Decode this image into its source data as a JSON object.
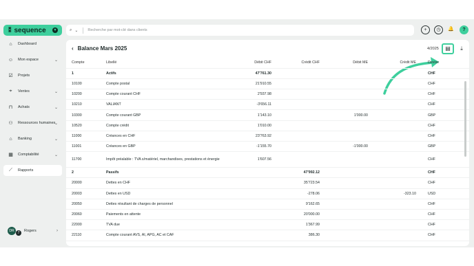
{
  "app": {
    "logo_text": "sequence",
    "logo_mark": "⁑"
  },
  "search": {
    "placeholder": "Recherche par mot-clé dans clients"
  },
  "sidebar": {
    "items": [
      {
        "label": "Dashboard"
      },
      {
        "label": "Mon espace"
      },
      {
        "label": "Projets"
      },
      {
        "label": "Ventes"
      },
      {
        "label": "Achats"
      },
      {
        "label": "Ressources humaines"
      },
      {
        "label": "Banking"
      },
      {
        "label": "Comptabilité"
      },
      {
        "label": "Rapports"
      }
    ],
    "user": {
      "name": "Rogers",
      "initials": "DR",
      "badge": "7"
    }
  },
  "report": {
    "title": "Balance Mars 2025",
    "date_fragment": "4/2025",
    "columns": [
      "Compte",
      "Libellé",
      "Débit CHF",
      "Crédit CHF",
      "Débit ME",
      "Crédit ME",
      "Devise"
    ],
    "rows": [
      {
        "compte": "1",
        "libelle": "Actifs",
        "debit": "47'761.30",
        "credit": "",
        "dme": "",
        "cme": "",
        "devise": "CHF",
        "bold": true
      },
      {
        "compte": "10100",
        "libelle": "Compte postal",
        "debit": "21'910.55",
        "credit": "",
        "dme": "",
        "cme": "",
        "devise": "CHF"
      },
      {
        "compte": "10200",
        "libelle": "Compte courant CHF",
        "debit": "2'937.98",
        "credit": "",
        "dme": "",
        "cme": "",
        "devise": "CHF"
      },
      {
        "compte": "10210",
        "libelle": "VALIANT",
        "debit": "-3'656.11",
        "credit": "",
        "dme": "",
        "cme": "",
        "devise": "CHF"
      },
      {
        "compte": "10300",
        "libelle": "Compte courant GBP",
        "debit": "1'143.10",
        "credit": "",
        "dme": "1'000.00",
        "cme": "",
        "devise": "GBP"
      },
      {
        "compte": "10520",
        "libelle": "Compte crédit",
        "debit": "1'010.00",
        "credit": "",
        "dme": "",
        "cme": "",
        "devise": "CHF"
      },
      {
        "compte": "11000",
        "libelle": "Créances en CHF",
        "debit": "23'763.92",
        "credit": "",
        "dme": "",
        "cme": "",
        "devise": "CHF"
      },
      {
        "compte": "11001",
        "libelle": "Créances en GBP",
        "debit": "-1'155.70",
        "credit": "",
        "dme": "-1'000.00",
        "cme": "",
        "devise": "GBP"
      },
      {
        "compte": "11700",
        "libelle": "Impôt préalable : TVA s/matériel, marchandises, prestations et énergie",
        "debit": "1'607.56",
        "credit": "",
        "dme": "",
        "cme": "",
        "devise": "CHF",
        "tall": true
      },
      {
        "compte": "2",
        "libelle": "Passifs",
        "debit": "",
        "credit": "47'992.12",
        "dme": "",
        "cme": "",
        "devise": "CHF",
        "bold": true
      },
      {
        "compte": "20000",
        "libelle": "Dettes en CHF",
        "debit": "",
        "credit": "35'723.54",
        "dme": "",
        "cme": "",
        "devise": "CHF"
      },
      {
        "compte": "20003",
        "libelle": "Dettes en USD",
        "debit": "",
        "credit": "-278.06",
        "dme": "",
        "cme": "-323.10",
        "devise": "USD"
      },
      {
        "compte": "20050",
        "libelle": "Dettes résultant de charges de personnel",
        "debit": "",
        "credit": "9'162.65",
        "dme": "",
        "cme": "",
        "devise": "CHF"
      },
      {
        "compte": "20060",
        "libelle": "Paiements en attente",
        "debit": "",
        "credit": "20'000.00",
        "dme": "",
        "cme": "",
        "devise": "CHF"
      },
      {
        "compte": "22000",
        "libelle": "TVA due",
        "debit": "",
        "credit": "1'367.99",
        "dme": "",
        "cme": "",
        "devise": "CHF"
      },
      {
        "compte": "22110",
        "libelle": "Compte courant AVS, AI, APG, AC et CAF",
        "debit": "",
        "credit": "386.30",
        "dme": "",
        "cme": "",
        "devise": "CHF"
      }
    ]
  },
  "colors": {
    "accent": "#3ecf9d",
    "background": "#eef0ef",
    "panel": "#ffffff"
  }
}
